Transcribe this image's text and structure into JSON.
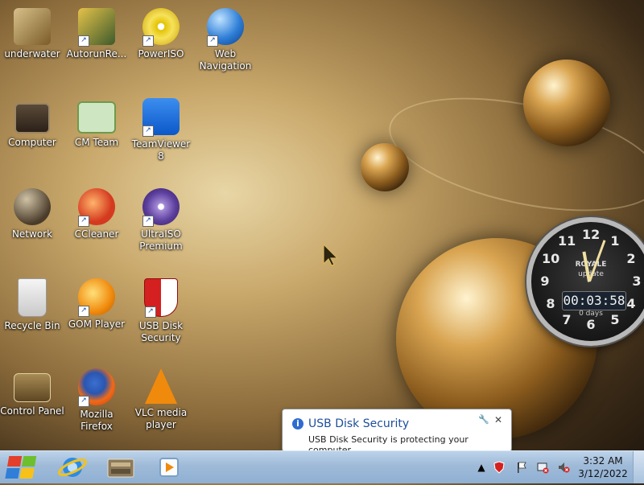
{
  "desktop_icons": [
    {
      "label": "underwater",
      "icon": "folder-icon"
    },
    {
      "label": "AutorunRe...",
      "icon": "usb-shield-icon"
    },
    {
      "label": "PowerISO",
      "icon": "disc-icon"
    },
    {
      "label": "Web\nNavigation",
      "icon": "globe-icon"
    },
    {
      "label": "Computer",
      "icon": "computer-icon"
    },
    {
      "label": "CM Team",
      "icon": "certificate-icon"
    },
    {
      "label": "TeamViewer 8",
      "icon": "teamviewer-icon"
    },
    {
      "label": "Network",
      "icon": "network-icon"
    },
    {
      "label": "CCleaner",
      "icon": "ccleaner-icon"
    },
    {
      "label": "UltraISO\nPremium",
      "icon": "ultraiso-icon"
    },
    {
      "label": "Recycle Bin",
      "icon": "recycle-bin-icon"
    },
    {
      "label": "GOM Player",
      "icon": "gom-player-icon"
    },
    {
      "label": "USB Disk\nSecurity",
      "icon": "shield-icon"
    },
    {
      "label": "Control Panel",
      "icon": "control-panel-icon"
    },
    {
      "label": "Mozilla Firefox",
      "icon": "firefox-icon"
    },
    {
      "label": "VLC media\nplayer",
      "icon": "vlc-cone-icon"
    }
  ],
  "clock_gadget": {
    "brand": "ROYALE",
    "sub": "update",
    "time": "00:03:58",
    "days": "0 days",
    "numbers": [
      "12",
      "1",
      "2",
      "3",
      "4",
      "5",
      "6",
      "7",
      "8",
      "9",
      "10",
      "11"
    ]
  },
  "balloon": {
    "title": "USB Disk Security",
    "message": "USB Disk Security is protecting your computer"
  },
  "taskbar": {
    "pinned": [
      "internet-explorer-icon",
      "windows-explorer-icon",
      "media-player-icon"
    ],
    "time": "3:32 AM",
    "date": "3/12/2022"
  }
}
